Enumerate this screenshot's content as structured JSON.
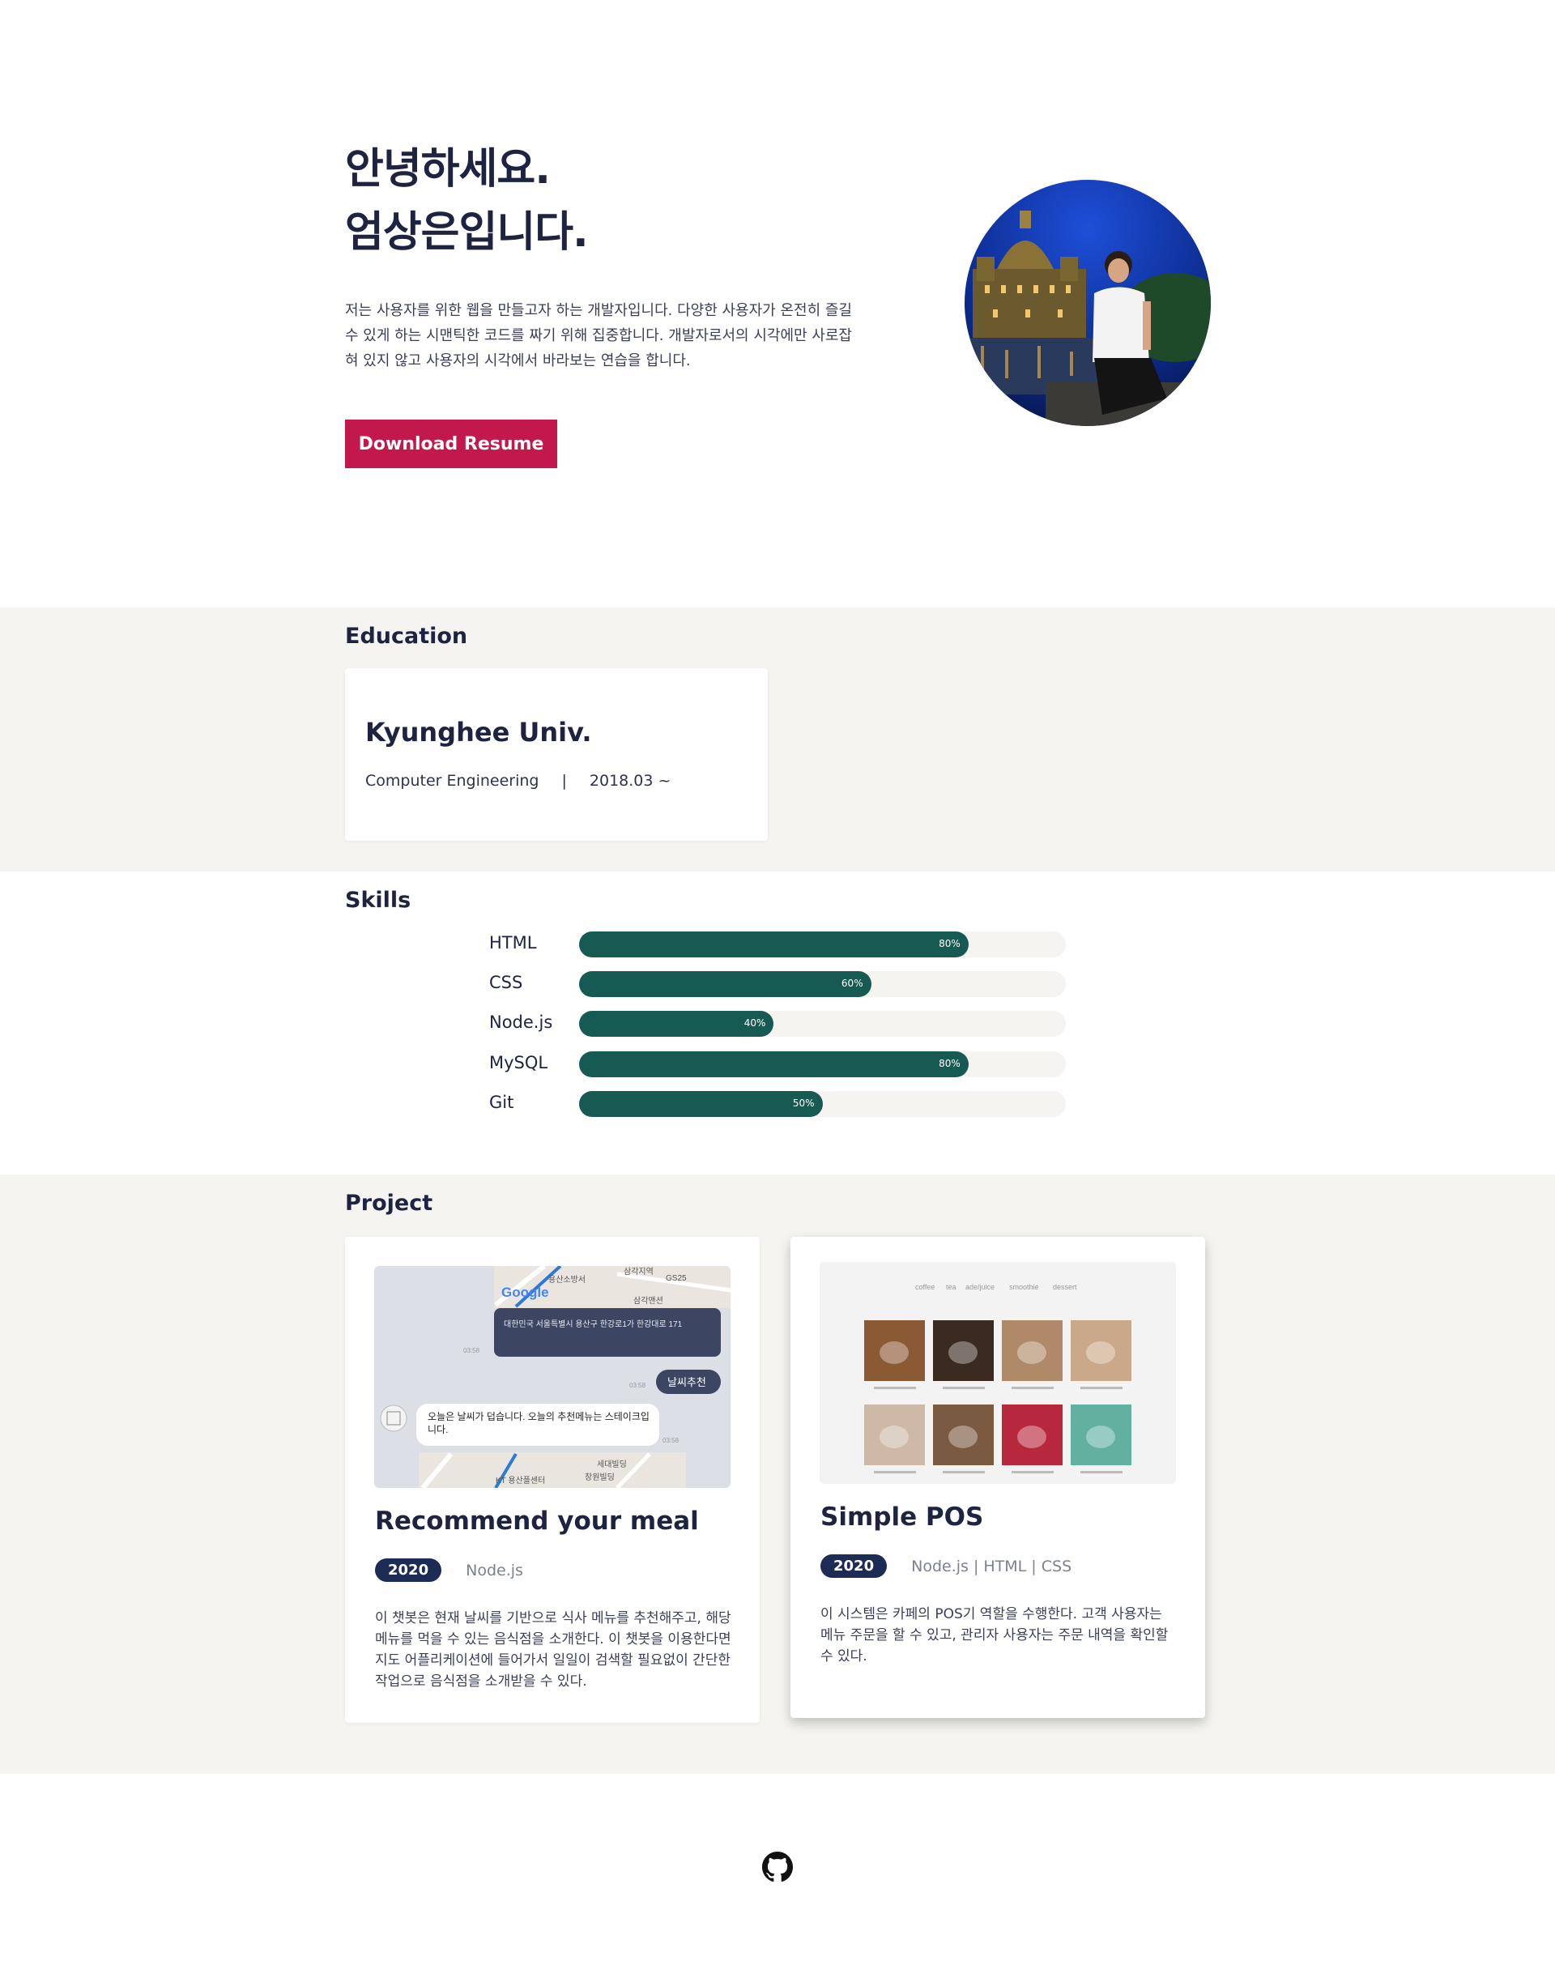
{
  "hero": {
    "title_line1": "안녕하세요.",
    "title_line2": "엄상은입니다.",
    "description": "저는 사용자를 위한 웹을 만들고자 하는 개발자입니다. 다양한 사용자가 온전히 즐길 수 있게 하는 시맨틱한 코드를 짜기 위해 집중합니다. 개발자로서의 시각에만 사로잡혀 있지 않고 사용자의 시각에서 바라보는 연습을 합니다.",
    "resume_button": "Download Resume"
  },
  "education": {
    "section_title": "Education",
    "school": "Kyunghee Univ.",
    "major": "Computer Engineering",
    "separator": "|",
    "period": "2018.03 ~"
  },
  "skills": {
    "section_title": "Skills",
    "items": [
      {
        "name": "HTML",
        "percent": 80,
        "label": "80%"
      },
      {
        "name": "CSS",
        "percent": 60,
        "label": "60%"
      },
      {
        "name": "Node.js",
        "percent": 40,
        "label": "40%"
      },
      {
        "name": "MySQL",
        "percent": 80,
        "label": "80%"
      },
      {
        "name": "Git",
        "percent": 50,
        "label": "50%"
      }
    ]
  },
  "projects": {
    "section_title": "Project",
    "items": [
      {
        "title": "Recommend your meal",
        "year": "2020",
        "tech": "Node.js",
        "description": "이 챗봇은 현재 날씨를 기반으로 식사 메뉴를 추천해주고, 해당 메뉴를 먹을 수 있는 음식점을 소개한다. 이 챗봇을 이용한다면 지도 어플리케이션에 들어가서 일일이 검색할 필요없이 간단한 작업으로 음식점을 소개받을 수 있다.",
        "screenshot": {
          "address": "대한민국 서울특별시 용산구 한강로1가 한강대로 171",
          "user_message": "날씨추천",
          "bot_message": "오늘은 날씨가 덥습니다. 오늘의 추천메뉴는 스테이크입니다.",
          "time": "03:58",
          "map_labels": [
            "용산소방서",
            "삼각지역",
            "GS25",
            "삼각맨션",
            "세대빌딩",
            "창원빌딩",
            "KT 용산플센터"
          ],
          "map_logo": "Google"
        }
      },
      {
        "title": "Simple POS",
        "year": "2020",
        "tech": "Node.js  |  HTML  |  CSS",
        "description": "이 시스템은 카페의 POS기 역할을 수행한다. 고객 사용자는 메뉴 주문을 할 수 있고, 관리자 사용자는 주문 내역을 확인할 수 있다.",
        "screenshot": {
          "tabs": [
            "coffee",
            "tea",
            "ade/juice",
            "smoothie",
            "dessert"
          ],
          "tile_colors": [
            "#8a5a35",
            "#3a2a20",
            "#b08a68",
            "#c9a98a",
            "#cdb9a6",
            "#7a5a40",
            "#b8283c",
            "#62b0a0"
          ]
        }
      }
    ]
  },
  "footer": {
    "github_icon": "github-icon"
  }
}
